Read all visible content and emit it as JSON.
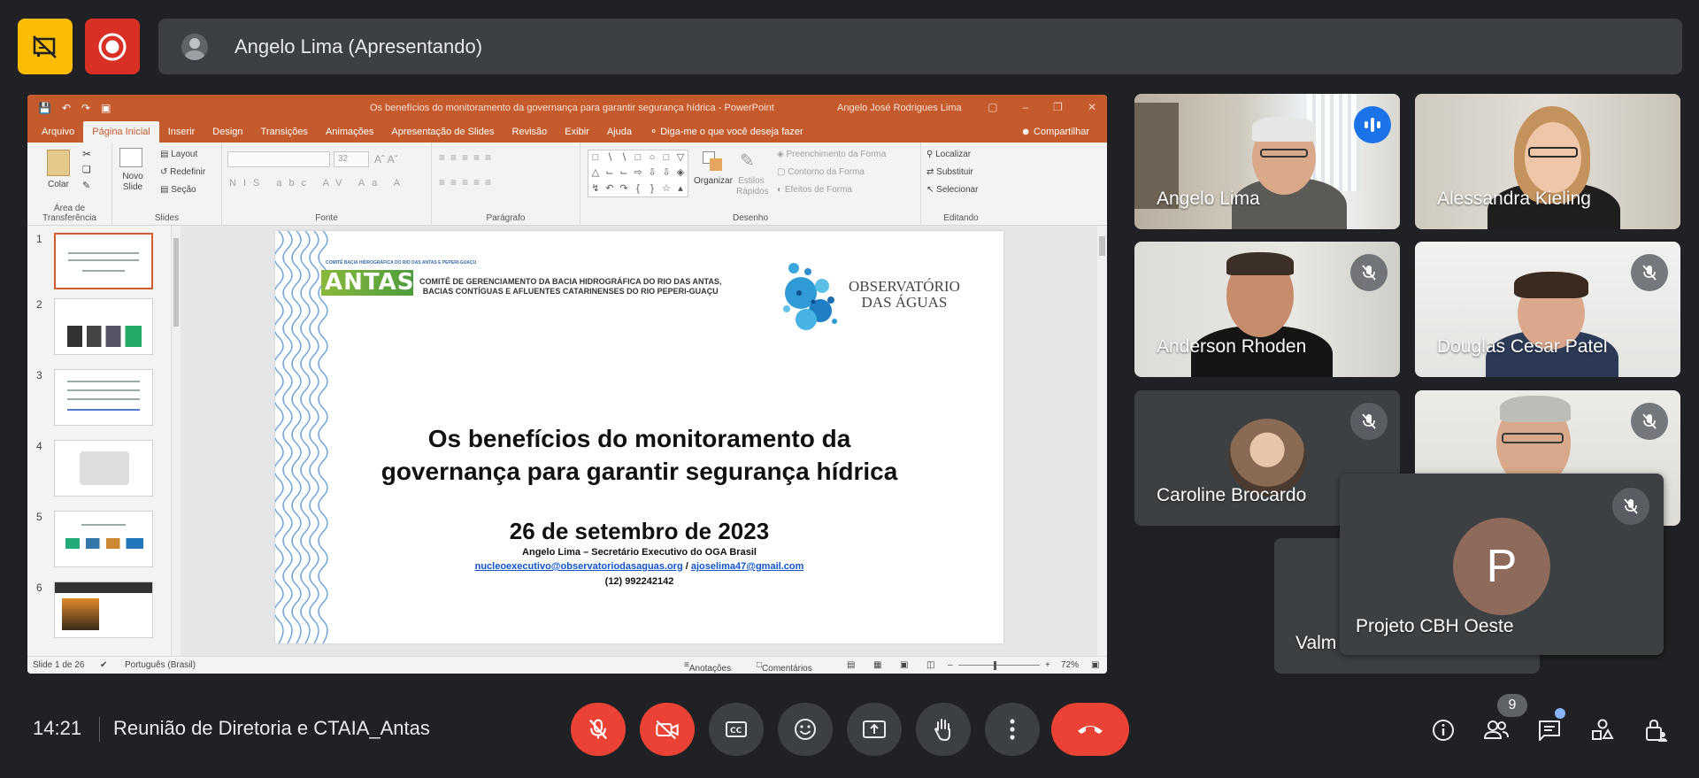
{
  "top": {
    "presenter_name": "Angelo Lima (Apresentando)"
  },
  "ppt": {
    "doc_title": "Os benefícios do monitoramento da governança para garantir segurança hídrica  -  PowerPoint",
    "user": "Angelo José Rodrigues Lima",
    "tabs": [
      "Arquivo",
      "Página Inicial",
      "Inserir",
      "Design",
      "Transições",
      "Animações",
      "Apresentação de Slides",
      "Revisão",
      "Exibir",
      "Ajuda"
    ],
    "tell_me": "Diga-me o que você deseja fazer",
    "share": "Compartilhar",
    "ribbon": {
      "paste": "Colar",
      "clipboard": "Área de Transferência",
      "new_slide": "Novo Slide",
      "layout": "Layout",
      "reset": "Redefinir",
      "section": "Seção",
      "slides": "Slides",
      "font_size": "32",
      "font": "Fonte",
      "paragraph": "Parágrafo",
      "organize": "Organizar",
      "quick_styles": "Estilos Rápidos",
      "shape_fill": "Preenchimento da Forma",
      "shape_outline": "Contorno da Forma",
      "shape_effects": "Efeitos de Forma",
      "drawing": "Desenho",
      "find": "Localizar",
      "replace": "Substituir",
      "select": "Selecionar",
      "editing": "Editando"
    },
    "thumb_numbers": [
      "1",
      "2",
      "3",
      "4",
      "5",
      "6"
    ],
    "slide": {
      "antas_sup": "COMITÊ BACIA HIDROGRÁFICA DO RIO DAS ANTAS E PEPERI-GUAÇU",
      "antas_logo": "ANTAS",
      "committee_line1": "COMITÊ DE GERENCIAMENTO DA BACIA HIDROGRÁFICA DO RIO DAS ANTAS,",
      "committee_line2": "BACIAS CONTÍGUAS E AFLUENTES CATARINENSES DO RIO PEPERI-GUAÇU",
      "oga_line1": "OBSERVATÓRIO",
      "oga_line2": "DAS ÁGUAS",
      "title_line1": "Os benefícios do monitoramento da",
      "title_line2": "governança para garantir segurança hídrica",
      "date": "26 de setembro de 2023",
      "author": "Angelo Lima – Secretário Executivo do OGA Brasil",
      "email1": "nucleoexecutivo@observatoriodasaguas.org",
      "email_sep": " / ",
      "email2": "ajoselima47@gmail.com",
      "phone": "(12) 992242142"
    },
    "status": {
      "slide_of": "Slide 1 de 26",
      "language": "Português (Brasil)",
      "notes": "Anotações",
      "comments": "Comentários",
      "zoom": "72%"
    }
  },
  "participants": [
    {
      "name": "Angelo Lima",
      "state": "speaking"
    },
    {
      "name": "Alessandra Kieling",
      "state": "unmuted"
    },
    {
      "name": "Anderson Rhoden",
      "state": "muted"
    },
    {
      "name": "Douglas Cesar Patel",
      "state": "muted"
    },
    {
      "name": "Caroline Brocardo",
      "state": "muted"
    },
    {
      "name": "",
      "state": "muted"
    },
    {
      "name": "Valm",
      "state": "hidden"
    },
    {
      "name": "Projeto CBH Oeste",
      "state": "muted",
      "initial": "P"
    }
  ],
  "bottom": {
    "time": "14:21",
    "meeting_name": "Reunião de Diretoria e CTAIA_Antas",
    "people_count": "9"
  },
  "colors": {
    "background": "#202124",
    "accent_red": "#ea4335",
    "accent_blue": "#8ab4f8",
    "ppt_orange": "#c55a2c",
    "avatar_brown": "#8d6a5a"
  }
}
